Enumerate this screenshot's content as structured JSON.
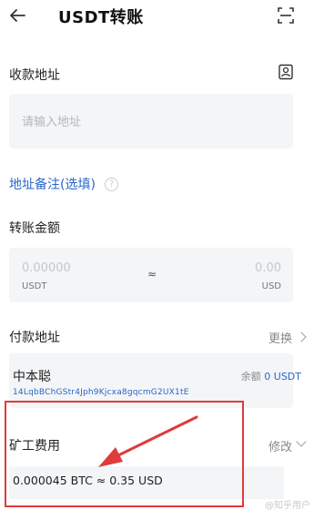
{
  "header": {
    "title": "USDT转账"
  },
  "recipient": {
    "label": "收款地址",
    "placeholder": "请输入地址"
  },
  "memo": {
    "label": "地址备注(选填)",
    "help_symbol": "?"
  },
  "amount": {
    "label": "转账金额",
    "crypto_value": "0.00000",
    "crypto_unit": "USDT",
    "approx_symbol": "≈",
    "fiat_value": "0.00",
    "fiat_unit": "USD"
  },
  "payer": {
    "label": "付款地址",
    "change_label": "更换",
    "name": "中本聪",
    "balance_label": "余额",
    "balance_value": "0 USDT",
    "address": "14LqbBChGStr4Jph9Kjcxa8gqcmG2UX1tE"
  },
  "fee": {
    "label": "矿工费用",
    "edit_label": "修改",
    "value": "0.000045 BTC ≈ 0.35 USD"
  },
  "colors": {
    "accent": "#2a66c8",
    "annotation": "#e03a3a"
  },
  "watermark": "@知乎用户"
}
